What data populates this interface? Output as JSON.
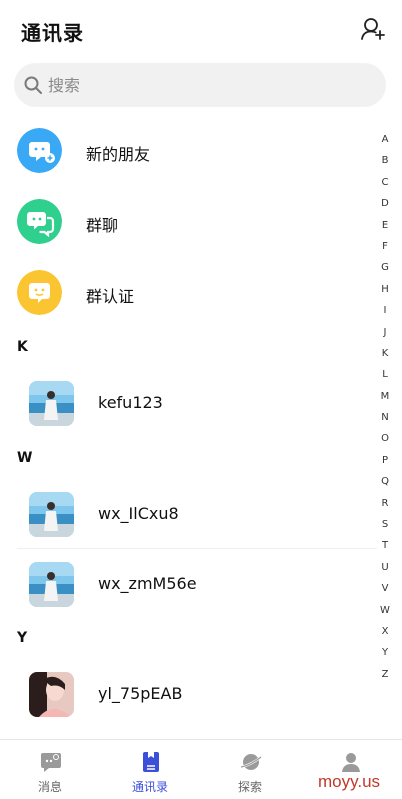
{
  "header": {
    "title": "通讯录",
    "add_friend_icon": "user-plus-icon"
  },
  "search": {
    "placeholder": "搜索",
    "icon": "search-icon"
  },
  "fixed_items": [
    {
      "label": "新的朋友",
      "icon": "chat-bubble-plus-icon",
      "color": "#3aa9f5"
    },
    {
      "label": "群聊",
      "icon": "chat-bubble-group-icon",
      "color": "#2fcf8d"
    },
    {
      "label": "群认证",
      "icon": "chat-bubble-badge-icon",
      "color": "#fbc531"
    }
  ],
  "sections": [
    {
      "letter": "K",
      "contacts": [
        {
          "name": "kefu123",
          "avatar": "beach-photo"
        }
      ]
    },
    {
      "letter": "W",
      "contacts": [
        {
          "name": "wx_IlCxu8",
          "avatar": "beach-photo"
        },
        {
          "name": "wx_zmM56e",
          "avatar": "beach-photo"
        }
      ]
    },
    {
      "letter": "Y",
      "contacts": [
        {
          "name": "yl_75pEAB",
          "avatar": "portrait-photo"
        }
      ]
    }
  ],
  "index_letters": [
    "A",
    "B",
    "C",
    "D",
    "E",
    "F",
    "G",
    "H",
    "I",
    "J",
    "K",
    "L",
    "M",
    "N",
    "O",
    "P",
    "Q",
    "R",
    "S",
    "T",
    "U",
    "V",
    "W",
    "X",
    "Y",
    "Z"
  ],
  "tabbar": {
    "active_color": "#3b4fd9",
    "inactive_color": "#9a9a9a",
    "tabs": [
      {
        "label": "消息",
        "icon": "message-icon",
        "active": false
      },
      {
        "label": "通讯录",
        "icon": "contacts-book-icon",
        "active": true
      },
      {
        "label": "探索",
        "icon": "planet-icon",
        "active": false
      },
      {
        "label": "",
        "icon": "person-icon",
        "active": false
      }
    ]
  },
  "watermark": "moyy.us"
}
